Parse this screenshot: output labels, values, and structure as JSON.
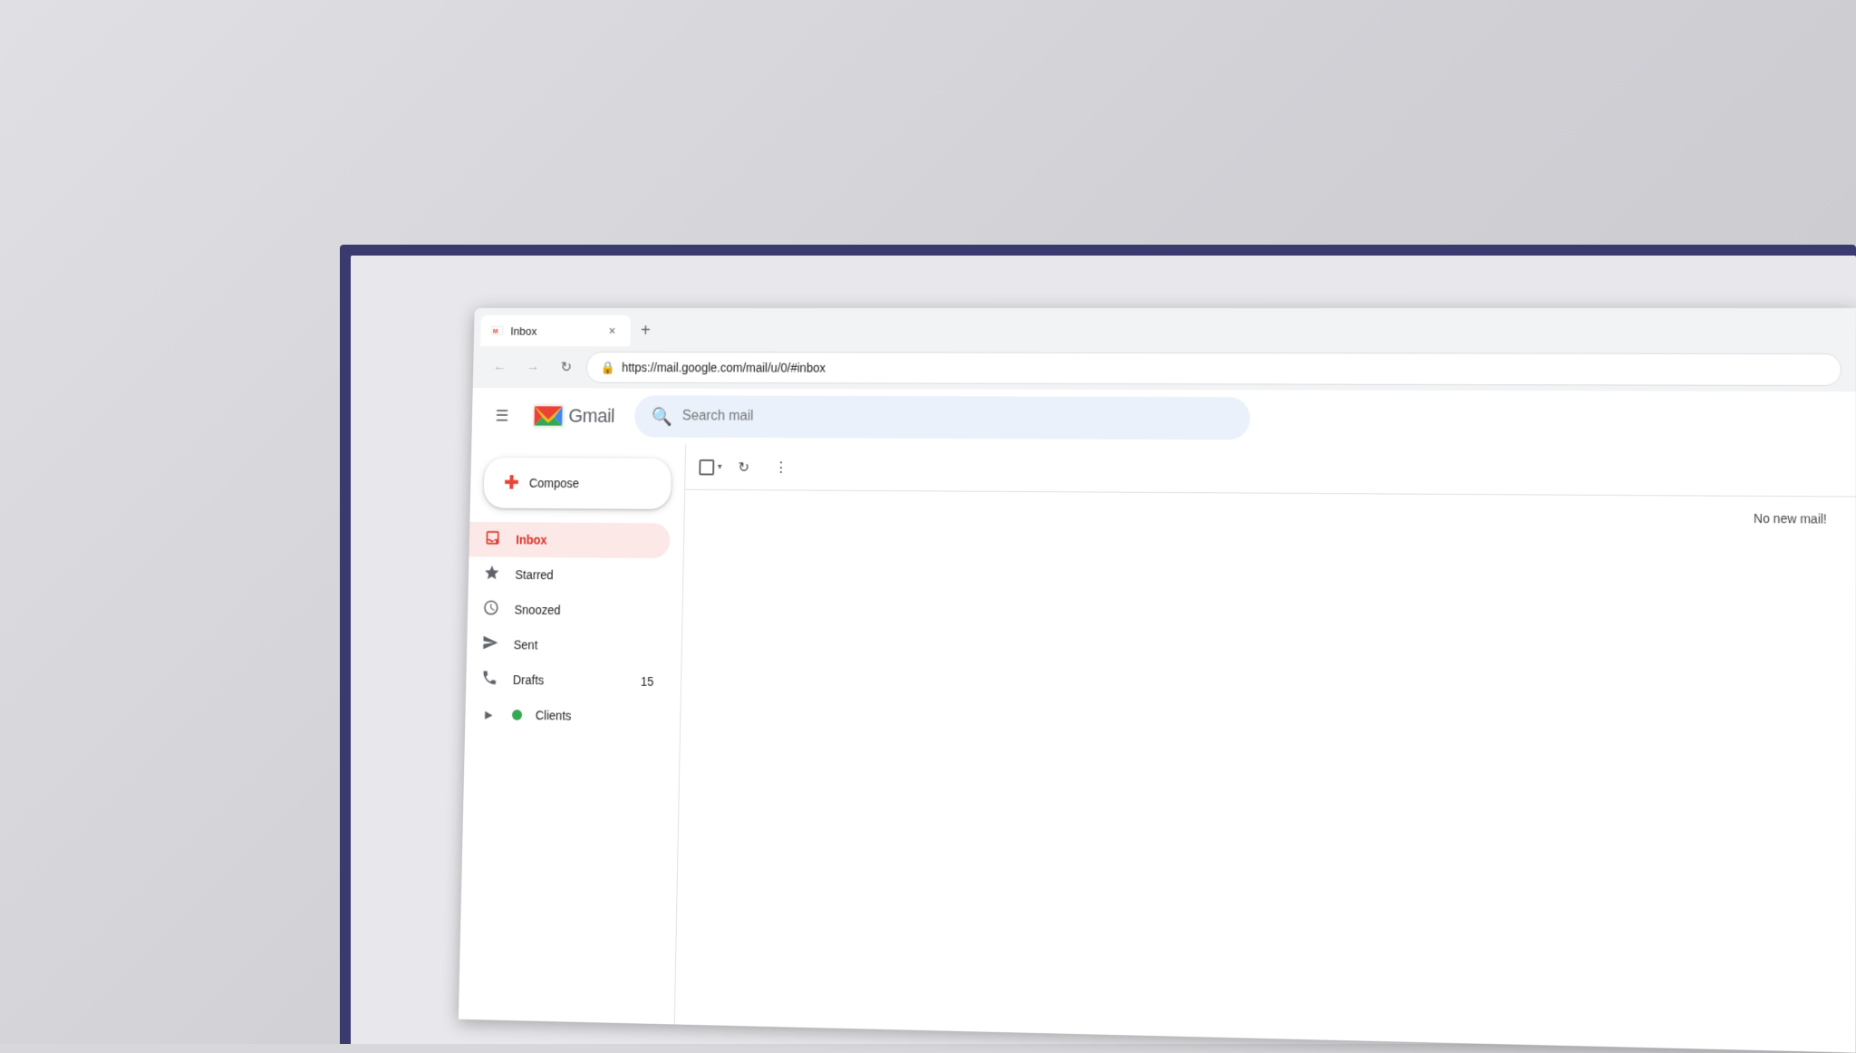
{
  "desktop": {
    "bg_color": "#d8d8dc"
  },
  "browser": {
    "tab": {
      "label": "Inbox",
      "favicon": "gmail"
    },
    "url": "https://mail.google.com/mail/u/0/#inbox",
    "close_symbol": "×",
    "new_tab_symbol": "+"
  },
  "nav": {
    "back_symbol": "←",
    "forward_symbol": "→",
    "reload_symbol": "↻",
    "lock_symbol": "🔒"
  },
  "gmail": {
    "app_name": "Gmail",
    "search_placeholder": "Search mail",
    "hamburger_symbol": "☰"
  },
  "toolbar": {
    "checkbox_symbol": "",
    "chevron_symbol": "▾",
    "refresh_symbol": "↻",
    "more_symbol": "⋮",
    "no_mail_text": "No new mail!"
  },
  "sidebar": {
    "compose_label": "Compose",
    "compose_icon": "+",
    "items": [
      {
        "id": "inbox",
        "label": "Inbox",
        "icon": "inbox",
        "active": true,
        "count": ""
      },
      {
        "id": "starred",
        "label": "Starred",
        "icon": "star",
        "active": false,
        "count": ""
      },
      {
        "id": "snoozed",
        "label": "Snoozed",
        "icon": "clock",
        "active": false,
        "count": ""
      },
      {
        "id": "sent",
        "label": "Sent",
        "icon": "send",
        "active": false,
        "count": ""
      },
      {
        "id": "drafts",
        "label": "Drafts",
        "icon": "draft",
        "active": false,
        "count": "15"
      },
      {
        "id": "clients",
        "label": "Clients",
        "icon": "label-dot",
        "active": false,
        "count": "",
        "expand": true
      }
    ]
  }
}
